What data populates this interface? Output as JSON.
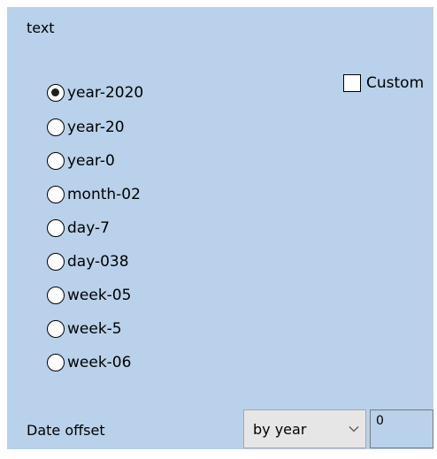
{
  "panel": {
    "title": "text",
    "background": "#b9d1ea"
  },
  "radios": [
    {
      "label": "year-2020",
      "checked": true
    },
    {
      "label": "year-20",
      "checked": false
    },
    {
      "label": "year-0",
      "checked": false
    },
    {
      "label": "month-02",
      "checked": false
    },
    {
      "label": "day-7",
      "checked": false
    },
    {
      "label": "day-038",
      "checked": false
    },
    {
      "label": "week-05",
      "checked": false
    },
    {
      "label": "week-5",
      "checked": false
    },
    {
      "label": "week-06",
      "checked": false
    }
  ],
  "custom": {
    "label": "Custom",
    "checked": false
  },
  "date_offset": {
    "label": "Date offset",
    "select_value": "by year",
    "input_value": "0"
  },
  "icons": {
    "dropdown": "chevron-down-icon"
  }
}
